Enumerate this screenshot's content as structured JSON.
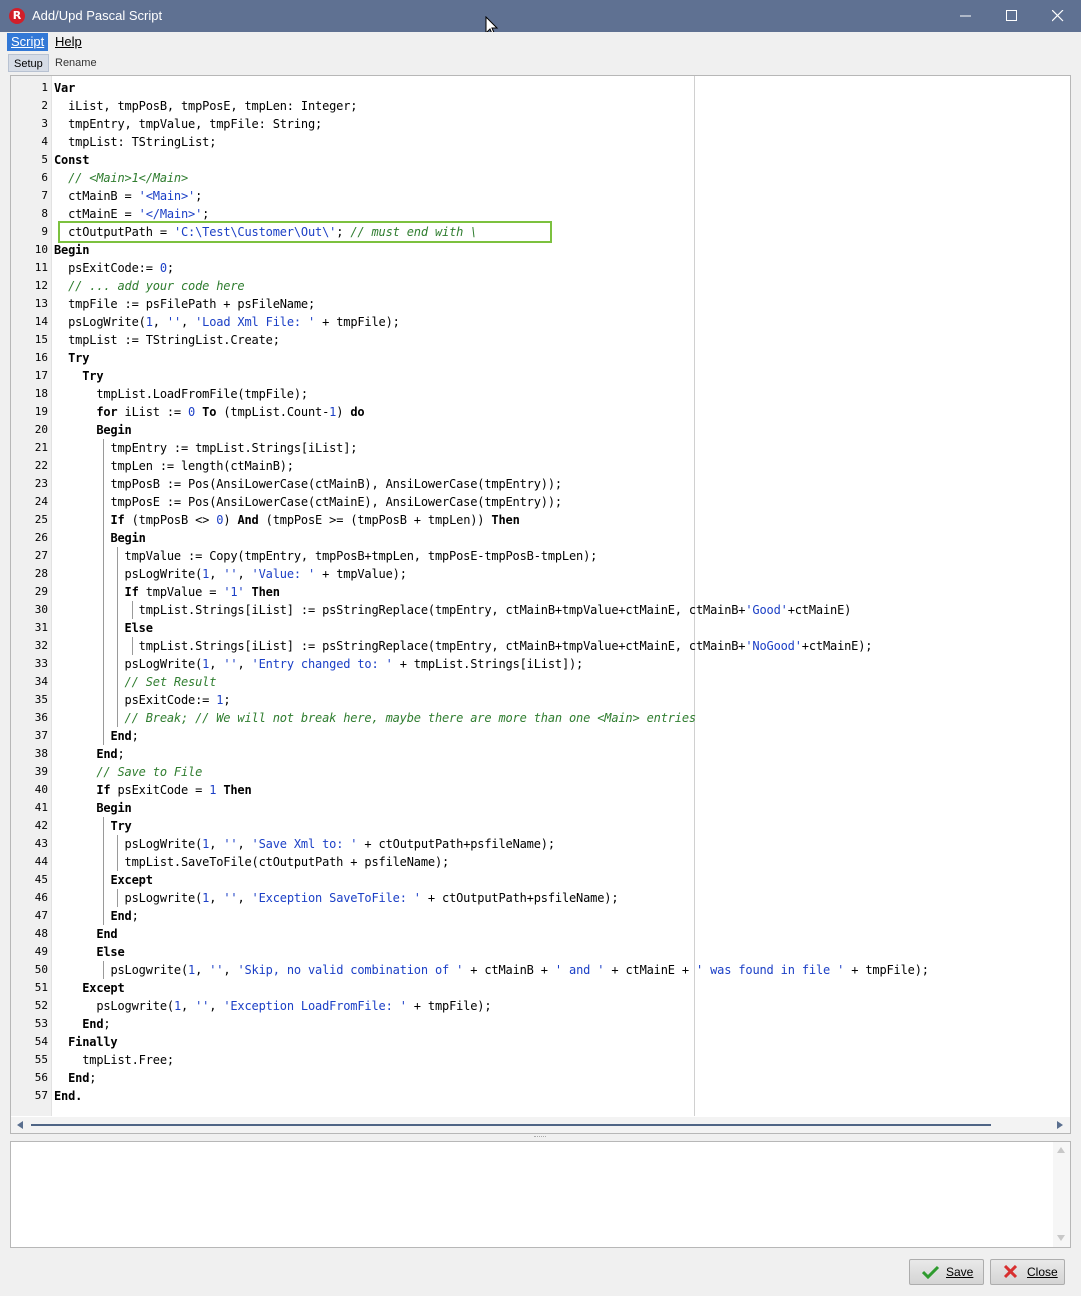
{
  "window": {
    "title": "Add/Upd Pascal Script",
    "app_icon_letter": "R"
  },
  "menu": [
    {
      "label": "Script",
      "active": true
    },
    {
      "label": "Help",
      "active": false
    }
  ],
  "tabs": [
    {
      "label": "Setup",
      "selected": true
    },
    {
      "label": "Rename",
      "selected": false
    }
  ],
  "editor": {
    "highlighted_line": 9,
    "colors": {
      "keyword": "#000000",
      "string": "#1b3fc6",
      "comment": "#2f7d2f",
      "highlight_box": "#7cc13f"
    },
    "lines": [
      {
        "n": "1",
        "indent": 0,
        "tokens": [
          [
            "kw",
            "Var"
          ]
        ]
      },
      {
        "n": "2",
        "indent": 2,
        "tokens": [
          [
            "t",
            "iList, tmpPosB, tmpPosE, tmpLen: Integer;"
          ]
        ]
      },
      {
        "n": "3",
        "indent": 2,
        "tokens": [
          [
            "t",
            "tmpEntry, tmpValue, tmpFile: String;"
          ]
        ]
      },
      {
        "n": "4",
        "indent": 2,
        "tokens": [
          [
            "t",
            "tmpList: TStringList;"
          ]
        ]
      },
      {
        "n": "5",
        "indent": 0,
        "tokens": [
          [
            "kw",
            "Const"
          ]
        ]
      },
      {
        "n": "6",
        "indent": 2,
        "tokens": [
          [
            "cmt",
            "// <Main>1</Main>"
          ]
        ]
      },
      {
        "n": "7",
        "indent": 2,
        "tokens": [
          [
            "t",
            "ctMainB = "
          ],
          [
            "str",
            "'<Main>'"
          ],
          [
            "t",
            ";"
          ]
        ]
      },
      {
        "n": "8",
        "indent": 2,
        "tokens": [
          [
            "t",
            "ctMainE = "
          ],
          [
            "str",
            "'</Main>'"
          ],
          [
            "t",
            ";"
          ]
        ]
      },
      {
        "n": "9",
        "indent": 2,
        "tokens": [
          [
            "t",
            "ctOutputPath = "
          ],
          [
            "str",
            "'C:\\Test\\Customer\\Out\\'"
          ],
          [
            "t",
            "; "
          ],
          [
            "cmt",
            "// must end with \\"
          ]
        ]
      },
      {
        "n": "10",
        "indent": 0,
        "tokens": [
          [
            "kw",
            "Begin"
          ]
        ]
      },
      {
        "n": "11",
        "indent": 2,
        "tokens": [
          [
            "t",
            "psExitCode:= "
          ],
          [
            "num",
            "0"
          ],
          [
            "t",
            ";"
          ]
        ]
      },
      {
        "n": "12",
        "indent": 2,
        "tokens": [
          [
            "cmt",
            "// ... add your code here"
          ]
        ]
      },
      {
        "n": "13",
        "indent": 2,
        "tokens": [
          [
            "t",
            "tmpFile := psFilePath + psFileName;"
          ]
        ]
      },
      {
        "n": "14",
        "indent": 2,
        "tokens": [
          [
            "t",
            "psLogWrite("
          ],
          [
            "num",
            "1"
          ],
          [
            "t",
            ", "
          ],
          [
            "str",
            "''"
          ],
          [
            "t",
            ", "
          ],
          [
            "str",
            "'Load Xml File: '"
          ],
          [
            "t",
            " + tmpFile);"
          ]
        ]
      },
      {
        "n": "15",
        "indent": 2,
        "tokens": [
          [
            "t",
            "tmpList := TStringList.Create;"
          ]
        ]
      },
      {
        "n": "16",
        "indent": 2,
        "tokens": [
          [
            "kw",
            "Try"
          ]
        ]
      },
      {
        "n": "17",
        "indent": 4,
        "tokens": [
          [
            "kw",
            "Try"
          ]
        ]
      },
      {
        "n": "18",
        "indent": 6,
        "tokens": [
          [
            "t",
            "tmpList.LoadFromFile(tmpFile);"
          ]
        ]
      },
      {
        "n": "19",
        "indent": 6,
        "tokens": [
          [
            "kw",
            "for"
          ],
          [
            "t",
            " iList := "
          ],
          [
            "num",
            "0"
          ],
          [
            "t",
            " "
          ],
          [
            "kw",
            "To"
          ],
          [
            "t",
            " (tmpList.Count-"
          ],
          [
            "num",
            "1"
          ],
          [
            "t",
            ") "
          ],
          [
            "kw",
            "do"
          ]
        ]
      },
      {
        "n": "20",
        "indent": 6,
        "tokens": [
          [
            "kw",
            "Begin"
          ]
        ]
      },
      {
        "n": "21",
        "indent": 8,
        "tokens": [
          [
            "t",
            "tmpEntry := tmpList.Strings[iList];"
          ]
        ]
      },
      {
        "n": "22",
        "indent": 8,
        "tokens": [
          [
            "t",
            "tmpLen := length(ctMainB);"
          ]
        ]
      },
      {
        "n": "23",
        "indent": 8,
        "tokens": [
          [
            "t",
            "tmpPosB := Pos(AnsiLowerCase(ctMainB), AnsiLowerCase(tmpEntry));"
          ]
        ]
      },
      {
        "n": "24",
        "indent": 8,
        "tokens": [
          [
            "t",
            "tmpPosE := Pos(AnsiLowerCase(ctMainE), AnsiLowerCase(tmpEntry));"
          ]
        ]
      },
      {
        "n": "25",
        "indent": 8,
        "tokens": [
          [
            "kw",
            "If"
          ],
          [
            "t",
            " (tmpPosB <> "
          ],
          [
            "num",
            "0"
          ],
          [
            "t",
            ") "
          ],
          [
            "kw",
            "And"
          ],
          [
            "t",
            " (tmpPosE >= (tmpPosB + tmpLen)) "
          ],
          [
            "kw",
            "Then"
          ]
        ]
      },
      {
        "n": "26",
        "indent": 8,
        "tokens": [
          [
            "kw",
            "Begin"
          ]
        ]
      },
      {
        "n": "27",
        "indent": 10,
        "tokens": [
          [
            "t",
            "tmpValue := Copy(tmpEntry, tmpPosB+tmpLen, tmpPosE-tmpPosB-tmpLen);"
          ]
        ]
      },
      {
        "n": "28",
        "indent": 10,
        "tokens": [
          [
            "t",
            "psLogWrite("
          ],
          [
            "num",
            "1"
          ],
          [
            "t",
            ", "
          ],
          [
            "str",
            "''"
          ],
          [
            "t",
            ", "
          ],
          [
            "str",
            "'Value: '"
          ],
          [
            "t",
            " + tmpValue);"
          ]
        ]
      },
      {
        "n": "29",
        "indent": 10,
        "tokens": [
          [
            "kw",
            "If"
          ],
          [
            "t",
            " tmpValue = "
          ],
          [
            "str",
            "'1'"
          ],
          [
            "t",
            " "
          ],
          [
            "kw",
            "Then"
          ]
        ]
      },
      {
        "n": "30",
        "indent": 12,
        "tokens": [
          [
            "t",
            "tmpList.Strings[iList] := psStringReplace(tmpEntry, ctMainB+tmpValue+ctMainE, ctMainB+"
          ],
          [
            "str",
            "'Good'"
          ],
          [
            "t",
            "+ctMainE)"
          ]
        ]
      },
      {
        "n": "31",
        "indent": 10,
        "tokens": [
          [
            "kw",
            "Else"
          ]
        ]
      },
      {
        "n": "32",
        "indent": 12,
        "tokens": [
          [
            "t",
            "tmpList.Strings[iList] := psStringReplace(tmpEntry, ctMainB+tmpValue+ctMainE, ctMainB+"
          ],
          [
            "str",
            "'NoGood'"
          ],
          [
            "t",
            "+ctMainE);"
          ]
        ]
      },
      {
        "n": "33",
        "indent": 10,
        "tokens": [
          [
            "t",
            "psLogWrite("
          ],
          [
            "num",
            "1"
          ],
          [
            "t",
            ", "
          ],
          [
            "str",
            "''"
          ],
          [
            "t",
            ", "
          ],
          [
            "str",
            "'Entry changed to: '"
          ],
          [
            "t",
            " + tmpList.Strings[iList]);"
          ]
        ]
      },
      {
        "n": "34",
        "indent": 10,
        "tokens": [
          [
            "cmt",
            "// Set Result"
          ]
        ]
      },
      {
        "n": "35",
        "indent": 10,
        "tokens": [
          [
            "t",
            "psExitCode:= "
          ],
          [
            "num",
            "1"
          ],
          [
            "t",
            ";"
          ]
        ]
      },
      {
        "n": "36",
        "indent": 10,
        "tokens": [
          [
            "cmt",
            "// Break; // We will not break here, maybe there are more than one <Main> entries"
          ]
        ]
      },
      {
        "n": "37",
        "indent": 8,
        "tokens": [
          [
            "kw",
            "End"
          ],
          [
            "t",
            ";"
          ]
        ]
      },
      {
        "n": "38",
        "indent": 6,
        "tokens": [
          [
            "kw",
            "End"
          ],
          [
            "t",
            ";"
          ]
        ]
      },
      {
        "n": "39",
        "indent": 6,
        "tokens": [
          [
            "cmt",
            "// Save to File"
          ]
        ]
      },
      {
        "n": "40",
        "indent": 6,
        "tokens": [
          [
            "kw",
            "If"
          ],
          [
            "t",
            " psExitCode = "
          ],
          [
            "num",
            "1"
          ],
          [
            "t",
            " "
          ],
          [
            "kw",
            "Then"
          ]
        ]
      },
      {
        "n": "41",
        "indent": 6,
        "tokens": [
          [
            "kw",
            "Begin"
          ]
        ]
      },
      {
        "n": "42",
        "indent": 8,
        "tokens": [
          [
            "kw",
            "Try"
          ]
        ]
      },
      {
        "n": "43",
        "indent": 10,
        "tokens": [
          [
            "t",
            "psLogWrite("
          ],
          [
            "num",
            "1"
          ],
          [
            "t",
            ", "
          ],
          [
            "str",
            "''"
          ],
          [
            "t",
            ", "
          ],
          [
            "str",
            "'Save Xml to: '"
          ],
          [
            "t",
            " + ctOutputPath+psfileName);"
          ]
        ]
      },
      {
        "n": "44",
        "indent": 10,
        "tokens": [
          [
            "t",
            "tmpList.SaveToFile(ctOutputPath + psfileName);"
          ]
        ]
      },
      {
        "n": "45",
        "indent": 8,
        "tokens": [
          [
            "kw",
            "Except"
          ]
        ]
      },
      {
        "n": "46",
        "indent": 10,
        "tokens": [
          [
            "t",
            "psLogwrite("
          ],
          [
            "num",
            "1"
          ],
          [
            "t",
            ", "
          ],
          [
            "str",
            "''"
          ],
          [
            "t",
            ", "
          ],
          [
            "str",
            "'Exception SaveToFile: '"
          ],
          [
            "t",
            " + ctOutputPath+psfileName);"
          ]
        ]
      },
      {
        "n": "47",
        "indent": 8,
        "tokens": [
          [
            "kw",
            "End"
          ],
          [
            "t",
            ";"
          ]
        ]
      },
      {
        "n": "48",
        "indent": 6,
        "tokens": [
          [
            "kw",
            "End"
          ]
        ]
      },
      {
        "n": "49",
        "indent": 6,
        "tokens": [
          [
            "kw",
            "Else"
          ]
        ]
      },
      {
        "n": "50",
        "indent": 8,
        "tokens": [
          [
            "t",
            "psLogwrite("
          ],
          [
            "num",
            "1"
          ],
          [
            "t",
            ", "
          ],
          [
            "str",
            "''"
          ],
          [
            "t",
            ", "
          ],
          [
            "str",
            "'Skip, no valid combination of '"
          ],
          [
            "t",
            " + ctMainB + "
          ],
          [
            "str",
            "' and '"
          ],
          [
            "t",
            " + ctMainE + "
          ],
          [
            "str",
            "' was found in file '"
          ],
          [
            "t",
            " + tmpFile);"
          ]
        ]
      },
      {
        "n": "51",
        "indent": 4,
        "tokens": [
          [
            "kw",
            "Except"
          ]
        ]
      },
      {
        "n": "52",
        "indent": 6,
        "tokens": [
          [
            "t",
            "psLogwrite("
          ],
          [
            "num",
            "1"
          ],
          [
            "t",
            ", "
          ],
          [
            "str",
            "''"
          ],
          [
            "t",
            ", "
          ],
          [
            "str",
            "'Exception LoadFromFile: '"
          ],
          [
            "t",
            " + tmpFile);"
          ]
        ]
      },
      {
        "n": "53",
        "indent": 4,
        "tokens": [
          [
            "kw",
            "End"
          ],
          [
            "t",
            ";"
          ]
        ]
      },
      {
        "n": "54",
        "indent": 2,
        "tokens": [
          [
            "kw",
            "Finally"
          ]
        ]
      },
      {
        "n": "55",
        "indent": 4,
        "tokens": [
          [
            "t",
            "tmpList.Free;"
          ]
        ]
      },
      {
        "n": "56",
        "indent": 2,
        "tokens": [
          [
            "kw",
            "End"
          ],
          [
            "t",
            ";"
          ]
        ]
      },
      {
        "n": "57",
        "indent": 0,
        "tokens": [
          [
            "kw",
            "End."
          ]
        ]
      }
    ]
  },
  "output_log": {
    "value": ""
  },
  "buttons": {
    "save_label": "Save",
    "close_label": "Close"
  },
  "icons": {
    "save": "check-icon",
    "close": "x-icon"
  }
}
